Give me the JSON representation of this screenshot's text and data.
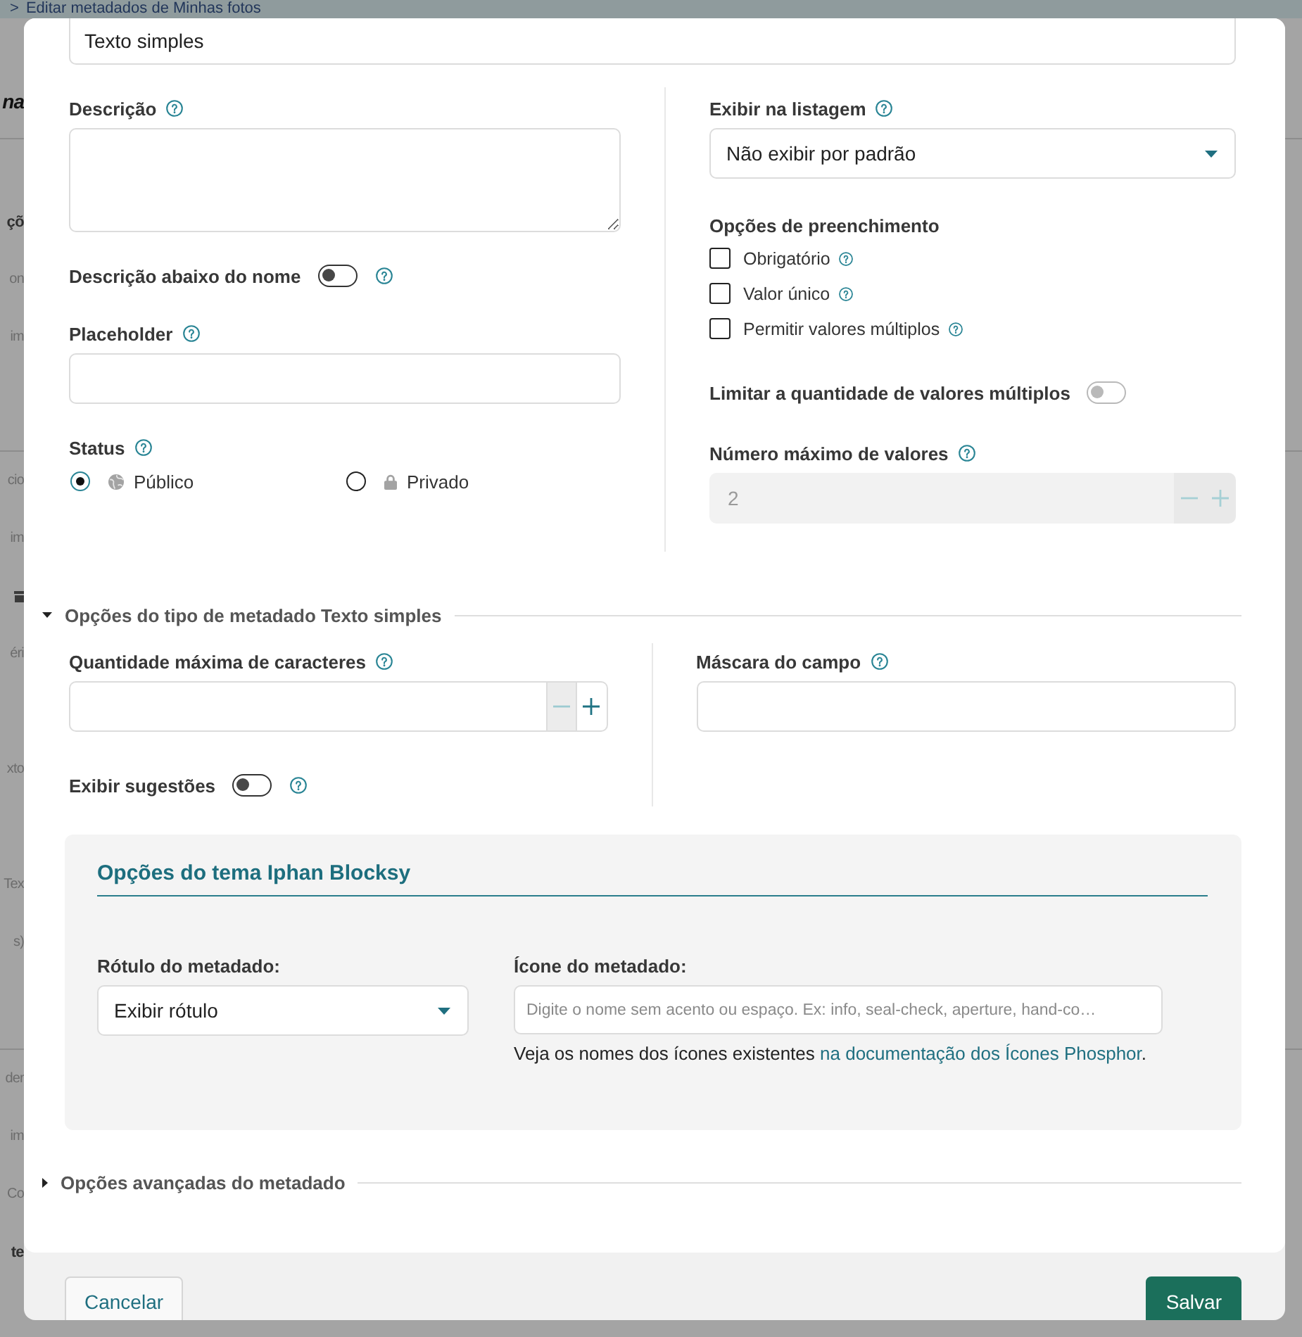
{
  "background_page": {
    "breadcrumb": {
      "separator": ">",
      "label": "Editar metadados de Minhas fotos"
    },
    "left_sections": [
      {
        "fragments": [
          {
            "kind": "heading",
            "text": "na"
          }
        ]
      },
      {
        "fragments": [
          {
            "kind": "label",
            "text": "çõ"
          },
          {
            "kind": "text",
            "text": "on"
          },
          {
            "kind": "text",
            "text": "im"
          }
        ]
      },
      {
        "fragments": [
          {
            "kind": "text",
            "text": "cio"
          },
          {
            "kind": "text",
            "text": "im"
          },
          {
            "kind": "icon"
          },
          {
            "kind": "text",
            "text": "éri"
          },
          {
            "kind": "text",
            "text": "xto"
          },
          {
            "kind": "text",
            "text": "Tex"
          },
          {
            "kind": "text",
            "text": "s)"
          }
        ]
      },
      {
        "fragments": [
          {
            "kind": "text",
            "text": "der"
          },
          {
            "kind": "text",
            "text": "im"
          },
          {
            "kind": "text",
            "text": "Co"
          },
          {
            "kind": "label",
            "text": "te"
          }
        ]
      }
    ]
  },
  "modal": {
    "type_field": {
      "value": "Texto simples"
    },
    "left_fields": [
      {
        "kind": "textarea",
        "label": "Descrição",
        "help": true
      },
      {
        "kind": "toggle",
        "label": "Descrição abaixo do nome",
        "help": true,
        "on": false,
        "disabled": false
      },
      {
        "kind": "text",
        "label": "Placeholder",
        "help": true
      },
      {
        "kind": "radios",
        "label": "Status",
        "help": true,
        "options": [
          {
            "kind": "public",
            "label": "Público",
            "selected": true
          },
          {
            "kind": "private",
            "label": "Privado",
            "selected": false
          }
        ]
      }
    ],
    "right_fields": [
      {
        "kind": "select",
        "label": "Exibir na listagem",
        "help": true,
        "value": "Não exibir por padrão"
      },
      {
        "kind": "checks",
        "label": "Opções de preenchimento",
        "help": false,
        "options": [
          {
            "label": "Obrigatório",
            "help": true,
            "checked": false
          },
          {
            "label": "Valor único",
            "help": true,
            "checked": false
          },
          {
            "label": "Permitir valores múltiplos",
            "help": true,
            "checked": false
          }
        ]
      },
      {
        "kind": "toggle",
        "label": "Limitar a quantidade de valores múltiplos",
        "help": false,
        "on": false,
        "disabled": true
      },
      {
        "kind": "number",
        "label": "Número máximo de valores",
        "help": true,
        "value": "2",
        "disabled": true,
        "buttons": [
          {
            "kind": "decrement",
            "disabled": true
          },
          {
            "kind": "increment",
            "disabled": true
          }
        ]
      }
    ],
    "type_options": {
      "title": "Opções do tipo de metadado Texto simples",
      "expanded": true,
      "left_fields": [
        {
          "kind": "number",
          "label": "Quantidade máxima de caracteres",
          "help": true,
          "disabled": false,
          "buttons": [
            {
              "kind": "decrement",
              "disabled": true
            },
            {
              "kind": "increment",
              "disabled": false
            }
          ]
        },
        {
          "kind": "toggle",
          "label": "Exibir sugestões",
          "help": true,
          "on": false,
          "disabled": false
        }
      ],
      "right_fields": [
        {
          "kind": "text",
          "label": "Máscara do campo",
          "help": true
        }
      ]
    },
    "theme_panel": {
      "title": "Opções do tema Iphan Blocksy",
      "fields": [
        {
          "kind": "select",
          "label": "Rótulo do metadado:",
          "help": false,
          "value": "Exibir rótulo"
        },
        {
          "kind": "icon_input",
          "label": "Ícone do metadado:",
          "help": false,
          "placeholder": "Digite o nome sem acento ou espaço. Ex: info, seal-check, aperture, hand-co…",
          "note": "Veja os nomes dos ícones existentes ",
          "link": "na documentação dos Ícones Phosphor",
          "note_end": "."
        }
      ]
    },
    "advanced": {
      "title": "Opções avançadas do metadado",
      "expanded": false
    },
    "footer": {
      "buttons": [
        {
          "kind": "secondary",
          "label": "Cancelar"
        },
        {
          "kind": "primary",
          "label": "Salvar"
        }
      ]
    }
  }
}
